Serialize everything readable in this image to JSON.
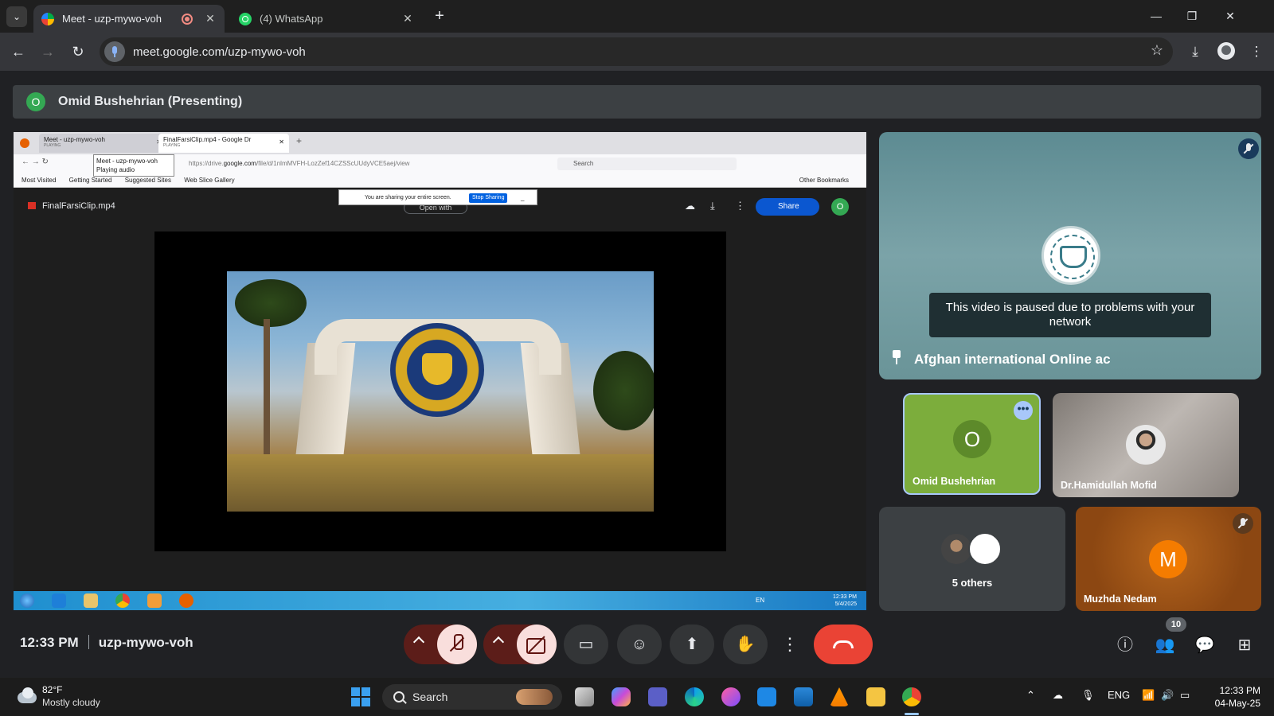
{
  "browser": {
    "tabs": [
      {
        "title": "Meet - uzp-mywo-voh",
        "active": true
      },
      {
        "title": "(4) WhatsApp",
        "active": false
      }
    ],
    "url": "meet.google.com/uzp-mywo-voh"
  },
  "meet": {
    "presenting_banner": {
      "avatar_initial": "O",
      "text": "Omid Bushehrian (Presenting)"
    },
    "main_tile": {
      "name": "Afghan international Online ac",
      "paused_message": "This video is paused due to problems with your network"
    },
    "participants": [
      {
        "name": "Omid Bushehrian",
        "initial": "O"
      },
      {
        "name": "Dr.Hamidullah Mofid"
      },
      {
        "name": "Muzhda Nedam",
        "initial": "M"
      }
    ],
    "others_label": "5 others",
    "footer": {
      "time": "12:33 PM",
      "meeting_code": "uzp-mywo-voh",
      "people_count": "10"
    }
  },
  "shared_screen": {
    "ff_tab1": "Meet - uzp-mywo-voh",
    "ff_tab1_sub": "PLAYING",
    "ff_tab2": "FinalFarsiClip.mp4 - Google Dr",
    "ff_tab2_sub": "PLAYING",
    "tooltip_line1": "Meet - uzp-mywo-voh",
    "tooltip_line2": "Playing audio",
    "url_prefix": "https://drive.",
    "url_domain": "google.com",
    "url_rest": "/file/d/1nlmMVFH-LozZef14CZSScUUdyVCE5aej/view",
    "search_placeholder": "Search",
    "bookmarks": [
      "Most Visited",
      "Getting Started",
      "Suggested Sites",
      "Web Slice Gallery"
    ],
    "other_bookmarks": "Other Bookmarks",
    "sharing_notice": "You are sharing your entire screen.",
    "stop_sharing": "Stop Sharing",
    "notice_min": "_",
    "file_name": "FinalFarsiClip.mp4",
    "open_with": "Open with",
    "share_label": "Share",
    "avatar_initial": "O",
    "tray_lang": "EN",
    "tray_time": "12:33 PM",
    "tray_date": "5/4/2025"
  },
  "taskbar": {
    "temperature": "82°F",
    "weather": "Mostly cloudy",
    "search_label": "Search",
    "lang": "ENG",
    "time": "12:33 PM",
    "date": "04-May-25"
  },
  "colors": {
    "meet_bg": "#202124",
    "presenter_green": "#34a853",
    "omid_tile": "#7cad3c",
    "muzhda_tile": "#b5651d",
    "hangup_red": "#ea4335",
    "muted_pill": "#f9dedc"
  }
}
